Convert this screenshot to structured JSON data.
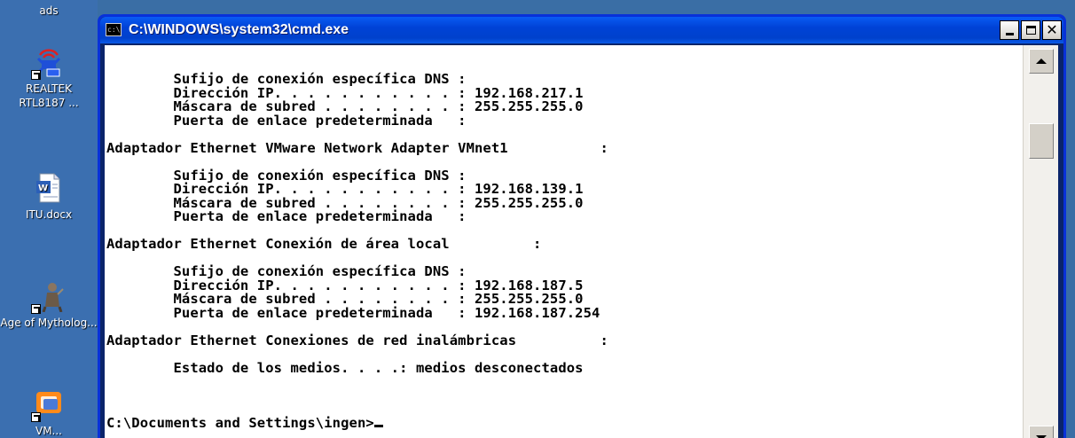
{
  "desktop": {
    "icons": [
      {
        "label": "ads",
        "icon": "folder-icon"
      },
      {
        "label": "REALTEK RTL8187 ...",
        "icon": "wireless-network-icon"
      },
      {
        "label": "ITU.docx",
        "icon": "word-document-icon"
      },
      {
        "label": "Age of Mytholog...",
        "icon": "game-icon"
      },
      {
        "label": "VM...",
        "icon": "vmware-icon"
      }
    ]
  },
  "window": {
    "title": "C:\\WINDOWS\\system32\\cmd.exe",
    "icon_text": "c:\\"
  },
  "console": {
    "lines": [
      "        Sufijo de conexión específica DNS :",
      "        Dirección IP. . . . . . . . . . . : 192.168.217.1",
      "        Máscara de subred . . . . . . . . : 255.255.255.0",
      "        Puerta de enlace predeterminada   :",
      "",
      "Adaptador Ethernet VMware Network Adapter VMnet1           :",
      "",
      "        Sufijo de conexión específica DNS :",
      "        Dirección IP. . . . . . . . . . . : 192.168.139.1",
      "        Máscara de subred . . . . . . . . : 255.255.255.0",
      "        Puerta de enlace predeterminada   :",
      "",
      "Adaptador Ethernet Conexión de área local          :",
      "",
      "        Sufijo de conexión específica DNS :",
      "        Dirección IP. . . . . . . . . . . : 192.168.187.5",
      "        Máscara de subred . . . . . . . . : 255.255.255.0",
      "        Puerta de enlace predeterminada   : 192.168.187.254",
      "",
      "Adaptador Ethernet Conexiones de red inalámbricas          :",
      "",
      "        Estado de los medios. . . .: medios desconectados",
      ""
    ],
    "prompt": "C:\\Documents and Settings\\ingen>"
  },
  "colors": {
    "titlebar": "#0042d6",
    "console_bg": "#ffffff",
    "console_fg": "#000000",
    "desktop": "#3b6fb0"
  }
}
